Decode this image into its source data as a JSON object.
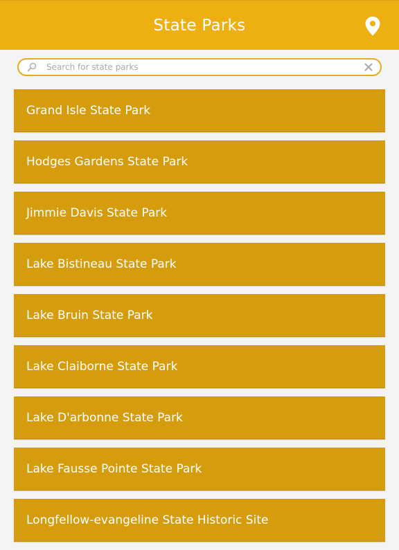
{
  "header": {
    "title": "State Parks",
    "location_icon": "location-pin-icon"
  },
  "search": {
    "placeholder": "Search for state parks",
    "value": "",
    "search_icon": "search-icon",
    "clear_icon": "close-icon"
  },
  "parks": [
    {
      "label": "Grand Isle State Park"
    },
    {
      "label": "Hodges Gardens State Park"
    },
    {
      "label": "Jimmie Davis State Park"
    },
    {
      "label": "Lake Bistineau State Park"
    },
    {
      "label": "Lake Bruin State Park"
    },
    {
      "label": "Lake Claiborne State Park"
    },
    {
      "label": "Lake D'arbonne State Park"
    },
    {
      "label": "Lake Fausse Pointe State Park"
    },
    {
      "label": "Longfellow-evangeline State Historic Site"
    }
  ],
  "colors": {
    "header_bg": "#ecb013",
    "item_bg": "#d59d0e",
    "page_bg": "#f4f4f4",
    "search_border": "#e6ad1a"
  }
}
